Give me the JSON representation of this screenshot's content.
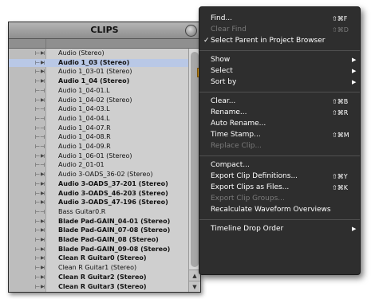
{
  "panel": {
    "title": "CLIPS",
    "clips": [
      {
        "name": "Audio (Stereo)",
        "bold": false,
        "twisty": true
      },
      {
        "name": "Audio 1_03 (Stereo)",
        "bold": true,
        "twisty": true,
        "selected": true
      },
      {
        "name": "Audio 1_03-01 (Stereo)",
        "bold": false,
        "twisty": true
      },
      {
        "name": "Audio 1_04 (Stereo)",
        "bold": true,
        "twisty": true
      },
      {
        "name": "Audio 1_04-01.L",
        "bold": false,
        "twisty": false
      },
      {
        "name": "Audio 1_04-02 (Stereo)",
        "bold": false,
        "twisty": true
      },
      {
        "name": "Audio 1_04-03.L",
        "bold": false,
        "twisty": false
      },
      {
        "name": "Audio 1_04-04.L",
        "bold": false,
        "twisty": false
      },
      {
        "name": "Audio 1_04-07.R",
        "bold": false,
        "twisty": false
      },
      {
        "name": "Audio 1_04-08.R",
        "bold": false,
        "twisty": false
      },
      {
        "name": "Audio 1_04-09.R",
        "bold": false,
        "twisty": false
      },
      {
        "name": "Audio 1_06-01 (Stereo)",
        "bold": false,
        "twisty": true
      },
      {
        "name": "Audio 2_01-01",
        "bold": false,
        "twisty": false
      },
      {
        "name": "Audio 3-OADS_36-02 (Stereo)",
        "bold": false,
        "twisty": true
      },
      {
        "name": "Audio 3-OADS_37-201 (Stereo)",
        "bold": true,
        "twisty": true
      },
      {
        "name": "Audio 3-OADS_46-203 (Stereo)",
        "bold": true,
        "twisty": true
      },
      {
        "name": "Audio 3-OADS_47-196 (Stereo)",
        "bold": true,
        "twisty": true
      },
      {
        "name": "Bass Guitar0.R",
        "bold": false,
        "twisty": false
      },
      {
        "name": "Blade Pad-GAIN_04-01 (Stereo)",
        "bold": true,
        "twisty": true
      },
      {
        "name": "Blade Pad-GAIN_07-08 (Stereo)",
        "bold": true,
        "twisty": true
      },
      {
        "name": "Blade Pad-GAIN_08 (Stereo)",
        "bold": true,
        "twisty": true
      },
      {
        "name": "Blade Pad-GAIN_09-08 (Stereo)",
        "bold": true,
        "twisty": true
      },
      {
        "name": "Clean R Guitar0 (Stereo)",
        "bold": true,
        "twisty": true
      },
      {
        "name": "Clean R Guitar1 (Stereo)",
        "bold": false,
        "twisty": true
      },
      {
        "name": "Clean R Guitar2 (Stereo)",
        "bold": true,
        "twisty": true
      },
      {
        "name": "Clean R Guitar3 (Stereo)",
        "bold": true,
        "twisty": true
      }
    ]
  },
  "menu": {
    "groups": [
      [
        {
          "label": "Find...",
          "shortcut": "⇧⌘F",
          "enabled": true
        },
        {
          "label": "Clear Find",
          "shortcut": "⇧⌘D",
          "enabled": false
        },
        {
          "label": "Select Parent in Project Browser",
          "shortcut": "",
          "enabled": true,
          "checked": true
        }
      ],
      [
        {
          "label": "Show",
          "submenu": true,
          "enabled": true
        },
        {
          "label": "Select",
          "submenu": true,
          "enabled": true
        },
        {
          "label": "Sort by",
          "submenu": true,
          "enabled": true
        }
      ],
      [
        {
          "label": "Clear...",
          "shortcut": "⇧⌘B",
          "enabled": true
        },
        {
          "label": "Rename...",
          "shortcut": "⇧⌘R",
          "enabled": true
        },
        {
          "label": "Auto Rename...",
          "shortcut": "",
          "enabled": true
        },
        {
          "label": "Time Stamp...",
          "shortcut": "⇧⌘M",
          "enabled": true
        },
        {
          "label": "Replace Clip...",
          "shortcut": "",
          "enabled": false
        }
      ],
      [
        {
          "label": "Compact...",
          "shortcut": "",
          "enabled": true
        },
        {
          "label": "Export Clip Definitions...",
          "shortcut": "⇧⌘Y",
          "enabled": true
        },
        {
          "label": "Export Clips as Files...",
          "shortcut": "⇧⌘K",
          "enabled": true
        },
        {
          "label": "Export Clip Groups...",
          "shortcut": "",
          "enabled": false
        },
        {
          "label": "Recalculate Waveform Overviews",
          "shortcut": "",
          "enabled": true
        }
      ],
      [
        {
          "label": "Timeline Drop Order",
          "submenu": true,
          "enabled": true
        }
      ]
    ],
    "checkmark": "✓",
    "submenu_arrow": "▶"
  },
  "icons": {
    "twisty": "▶",
    "clip_glyph": "⊢⊣",
    "scroll_up": "▲",
    "scroll_down": "▼"
  }
}
